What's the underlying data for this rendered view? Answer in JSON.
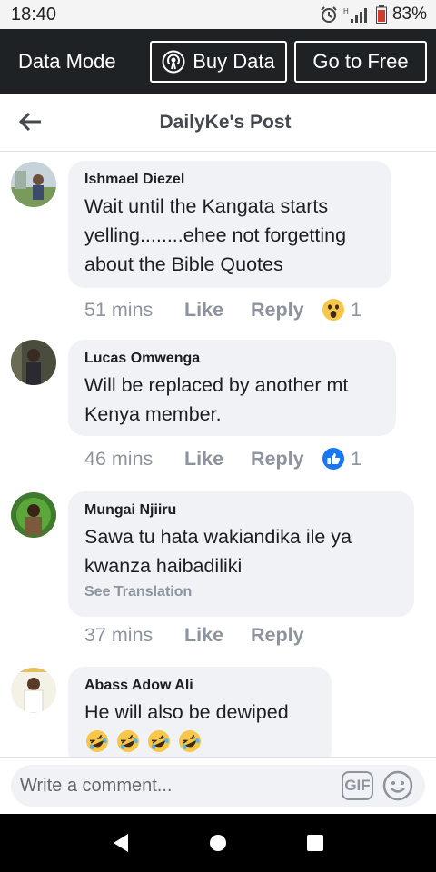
{
  "status_bar": {
    "time": "18:40",
    "battery": "83%"
  },
  "data_bar": {
    "title": "Data Mode",
    "buy_label": "Buy Data",
    "free_label": "Go to Free"
  },
  "header": {
    "title": "DailyKe's Post"
  },
  "comments": [
    {
      "author": "Ishmael Diezel",
      "lines": [
        "Wait until the Kangata starts",
        "yelling........ehee not forgetting",
        "about the Bible Quotes"
      ],
      "time": "51 mins",
      "like": "Like",
      "reply": "Reply",
      "reaction": "wow",
      "reaction_count": "1"
    },
    {
      "author": "Lucas Omwenga",
      "lines": [
        "Will be replaced by another mt",
        "Kenya member."
      ],
      "time": "46 mins",
      "like": "Like",
      "reply": "Reply",
      "reaction": "like",
      "reaction_count": "1"
    },
    {
      "author": "Mungai Njiiru",
      "lines": [
        "Sawa tu  hata  wakiandika ile  ya",
        "kwanza haibadiliki"
      ],
      "translate": "See Translation",
      "time": "37 mins",
      "like": "Like",
      "reply": "Reply"
    },
    {
      "author": "Abass Adow Ali",
      "lines": [
        "He will also be dewiped"
      ],
      "emojis": [
        "rolling-on-floor-laughing",
        "rolling-on-floor-laughing",
        "rolling-on-floor-laughing",
        "rolling-on-floor-laughing"
      ]
    }
  ],
  "composer": {
    "placeholder": "Write a comment...",
    "gif_label": "GIF"
  },
  "colors": {
    "data_bar_bg": "#1f2225",
    "bubble_bg": "#f0f2f5",
    "like_blue": "#1877f2",
    "meta_gray": "#8d949e"
  }
}
